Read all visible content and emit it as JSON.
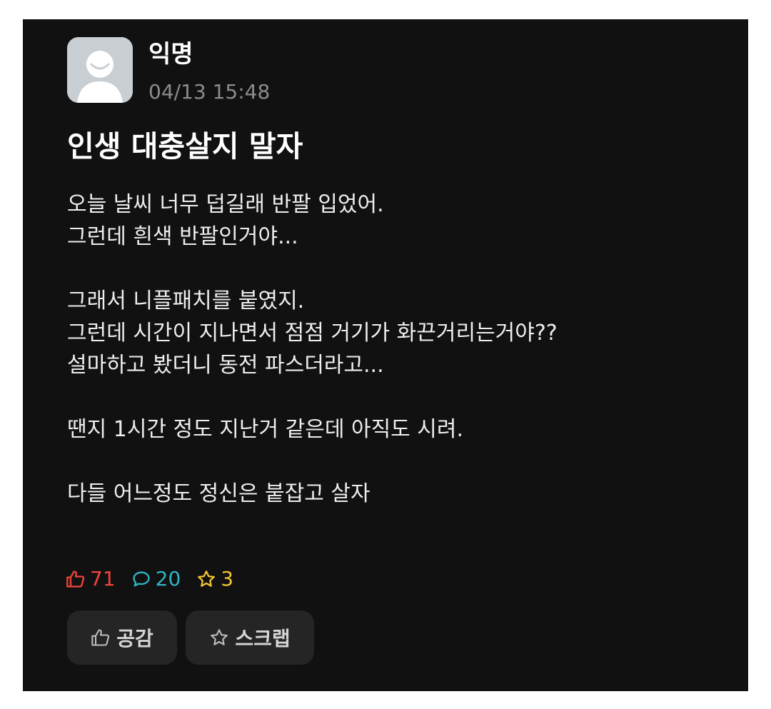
{
  "post": {
    "author": "익명",
    "timestamp": "04/13 15:48",
    "title": "인생 대충살지 말자",
    "body_lines": [
      "오늘 날씨 너무 덥길래 반팔 입었어.",
      "그런데 흰색 반팔인거야...",
      "",
      "그래서 니플패치를 붙였지.",
      "그런데 시간이 지나면서 점점 거기가 화끈거리는거야??",
      "설마하고 봤더니 동전 파스더라고...",
      "",
      "땐지 1시간 정도 지난거 같은데 아직도 시려.",
      "",
      "다들 어느정도 정신은 붙잡고 살자"
    ]
  },
  "stats": {
    "likes": "71",
    "comments": "20",
    "scraps": "3",
    "like_color": "#f0443c",
    "comment_color": "#2fb5c3",
    "scrap_color": "#f2c233",
    "like_icon": "thumbs-up-icon",
    "comment_icon": "speech-bubble-icon",
    "scrap_icon": "star-icon"
  },
  "actions": {
    "like_label": "공감",
    "scrap_label": "스크랩"
  }
}
